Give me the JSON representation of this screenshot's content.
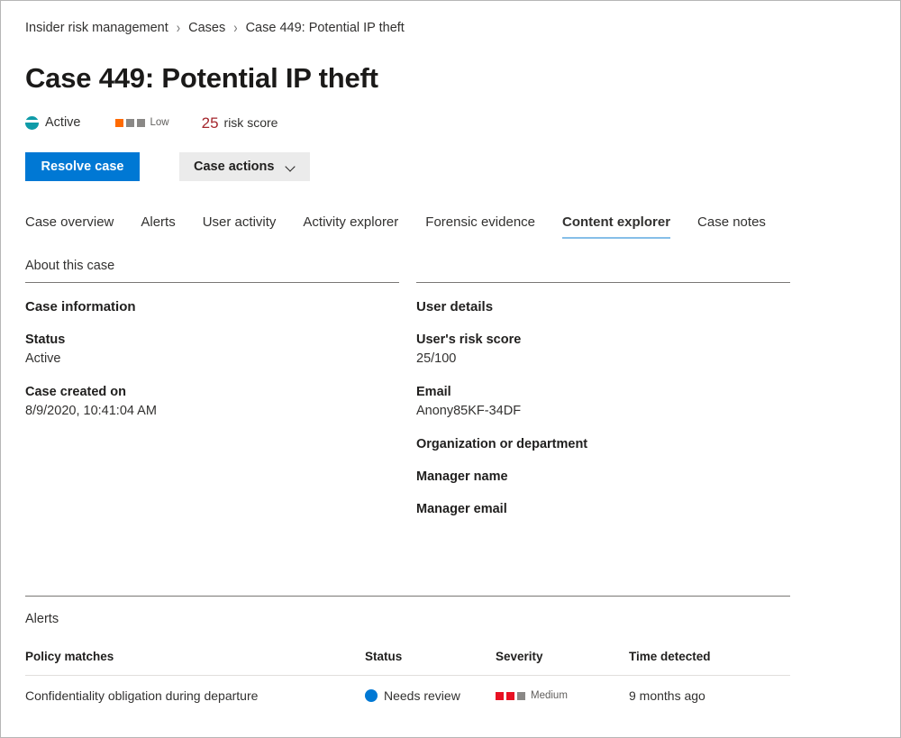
{
  "breadcrumb": {
    "items": [
      {
        "label": "Insider risk management",
        "link": true
      },
      {
        "label": "Cases",
        "link": true
      },
      {
        "label": "Case 449: Potential IP theft",
        "link": false
      }
    ],
    "separator": "›"
  },
  "header": {
    "title": "Case 449: Potential IP theft",
    "status": {
      "icon": "status-active-icon",
      "label": "Active",
      "color": "#0f9ba8"
    },
    "severity": {
      "label": "Low",
      "filled": 1,
      "total": 3,
      "fill_color": "#ff6a00",
      "empty_color": "#8a8886"
    },
    "risk_score": {
      "value": "25",
      "label": "risk score",
      "color": "#a4262c"
    }
  },
  "toolbar": {
    "resolve_label": "Resolve case",
    "resolve_color": "#0078d4",
    "case_actions_label": "Case actions",
    "case_actions_icon": "chevron-down-icon"
  },
  "tabs": {
    "active_index": 5,
    "active_underline_color": "#86bfe8",
    "items": [
      {
        "label": "Case overview"
      },
      {
        "label": "Alerts"
      },
      {
        "label": "User activity"
      },
      {
        "label": "Activity explorer"
      },
      {
        "label": "Forensic evidence"
      },
      {
        "label": "Content explorer"
      },
      {
        "label": "Case notes"
      }
    ]
  },
  "about": {
    "section_title": "About this case",
    "case_information": {
      "heading": "Case information",
      "fields": [
        {
          "label": "Status",
          "value": "Active"
        },
        {
          "label": "Case created on",
          "value": "8/9/2020, 10:41:04 AM"
        }
      ]
    },
    "user_details": {
      "heading": "User details",
      "fields": [
        {
          "label": "User's risk score",
          "value": "25/100"
        },
        {
          "label": "Email",
          "value": "Anony85KF-34DF"
        },
        {
          "label": "Organization or department",
          "value": ""
        },
        {
          "label": "Manager name",
          "value": ""
        },
        {
          "label": "Manager email",
          "value": ""
        }
      ]
    }
  },
  "alerts": {
    "heading": "Alerts",
    "columns": [
      "Policy matches",
      "Status",
      "Severity",
      "Time detected"
    ],
    "rows": [
      {
        "policy": "Confidentiality obligation during departure",
        "status": "Needs review",
        "status_color": "#0078d4",
        "severity": "Medium",
        "severity_filled": 2,
        "severity_total": 3,
        "severity_fill_color": "#e81123",
        "severity_empty_color": "#8a8886",
        "time": "9 months ago"
      }
    ]
  }
}
